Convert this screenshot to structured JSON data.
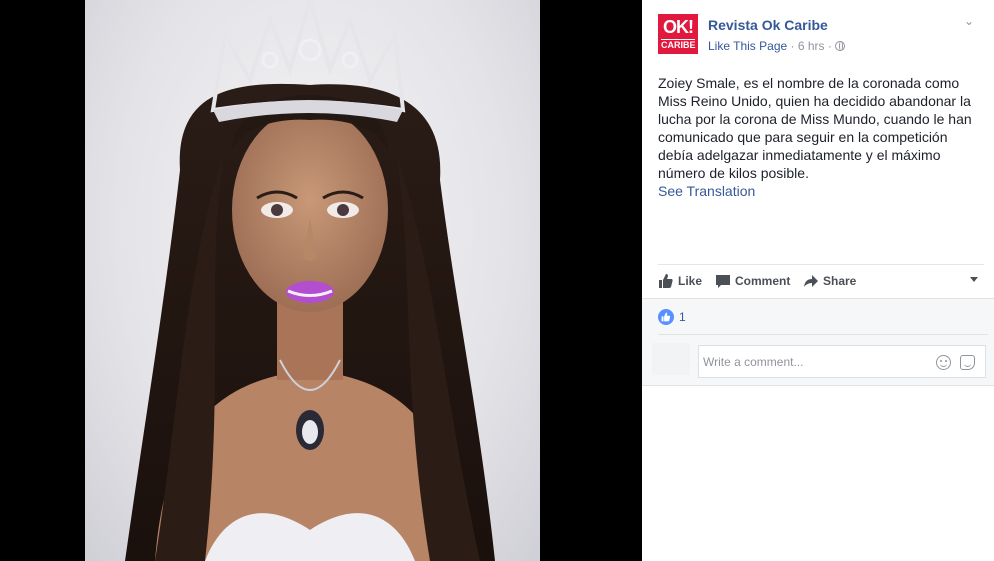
{
  "post": {
    "page_name": "Revista Ok Caribe",
    "logo": {
      "line1": "OK!",
      "line2": "CARIBE",
      "color": "#e1193e"
    },
    "like_page": "Like This Page",
    "separator": " · ",
    "time": "6 hrs",
    "audience_icon": "globe-icon",
    "options_icon": "chevron-down-icon",
    "text": "Zoiey Smale, es el nombre de la coronada como Miss Reino Unido, quien ha decidido abandonar la lucha por la corona de Miss Mundo, cuando le han comunicado que para seguir en la competición debía adelgazar inmediatamente y el máximo número de kilos posible.",
    "see_translation": "See Translation"
  },
  "actions": {
    "like": "Like",
    "comment": "Comment",
    "share": "Share"
  },
  "reactions": {
    "count": "1",
    "color": "#5890ff"
  },
  "comment_input": {
    "placeholder": "Write a comment..."
  },
  "colors": {
    "link": "#365899",
    "text": "#1d2129",
    "muted": "#90949c",
    "feedback_bg": "#f6f7f9"
  }
}
